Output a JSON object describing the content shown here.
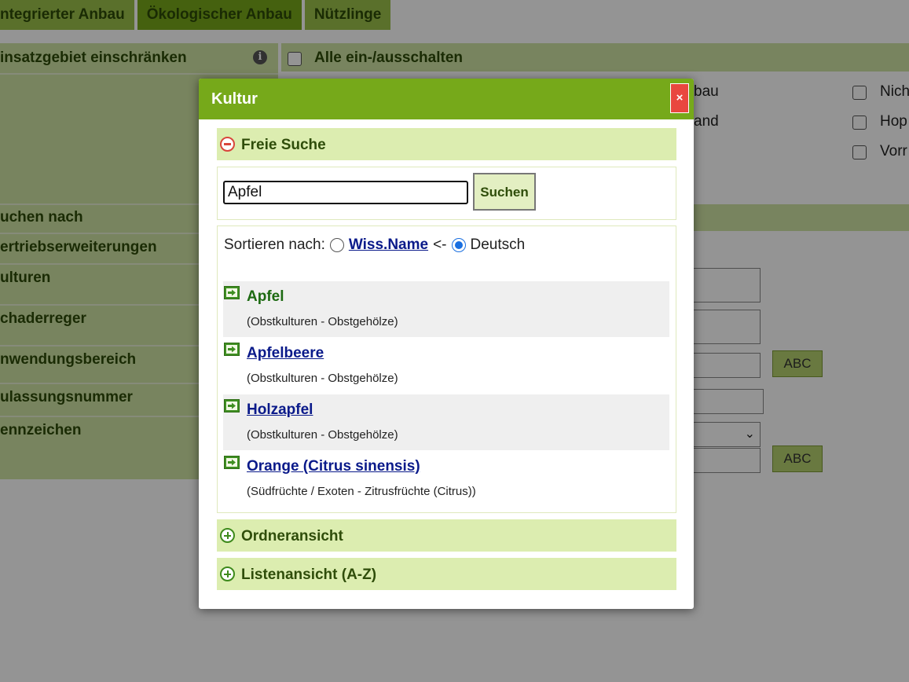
{
  "background": {
    "tabs": [
      "ntegrierter Anbau",
      "Ökologischer Anbau",
      "Nützlinge"
    ],
    "left_rows": [
      "insatzgebiet einschränken",
      "uchen nach",
      "ertriebserweiterungen",
      "ulturen",
      "chaderreger",
      "nwendungsbereich",
      "ulassungsnummer",
      "ennzeichen"
    ],
    "right_header": "Alle ein-/ausschalten",
    "right_texts": [
      "bau",
      "and"
    ],
    "right_checkboxes": [
      "Nich",
      "Hop",
      "Vorr"
    ],
    "abc_buttons": [
      "ABC",
      "ABC"
    ]
  },
  "dialog": {
    "title": "Kultur",
    "close_label": "×",
    "free_search": {
      "label": "Freie Suche",
      "query": "Apfel",
      "button": "Suchen"
    },
    "sort": {
      "label": "Sortieren nach:",
      "option_sci": "Wiss.Name",
      "arrow": "<-",
      "option_de": "Deutsch",
      "selected": "Deutsch"
    },
    "results": [
      {
        "name": "Apfel",
        "category": "(Obstkulturen - Obstgehölze)"
      },
      {
        "name": "Apfelbeere",
        "category": "(Obstkulturen - Obstgehölze)"
      },
      {
        "name": "Holzapfel",
        "category": "(Obstkulturen - Obstgehölze)"
      },
      {
        "name": "Orange (Citrus sinensis)",
        "category": "(Südfrüchte / Exoten - Zitrusfrüchte (Citrus))"
      }
    ],
    "folder_view": "Ordneransicht",
    "list_view": "Listenansicht (A-Z)"
  },
  "colors": {
    "header_green": "#76a91a",
    "section_green": "#dcedb0",
    "close_red": "#e9473f",
    "link_blue": "#0a1a8a"
  }
}
